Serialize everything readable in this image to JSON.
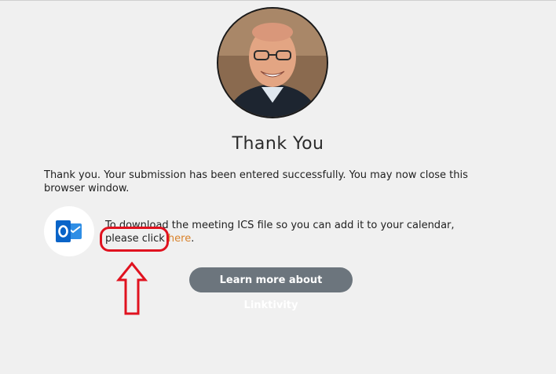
{
  "heading": "Thank You",
  "message": "Thank you. Your submission has been entered successfully. You may now close this browser window.",
  "ics": {
    "text_before": "To download the meeting ICS file so you can add it to your calendar, please click ",
    "link_text": "here",
    "text_after": ".",
    "icon": "outlook-icon"
  },
  "learn_more_button": "Learn more about Linktivity",
  "colors": {
    "background": "#f0f0f0",
    "link": "#d9822b",
    "button": "#6c757d",
    "highlight": "#e0121f",
    "outlook_blue": "#0a64c8"
  },
  "icons": [
    "profile-photo",
    "outlook-icon",
    "up-arrow-annotation"
  ]
}
